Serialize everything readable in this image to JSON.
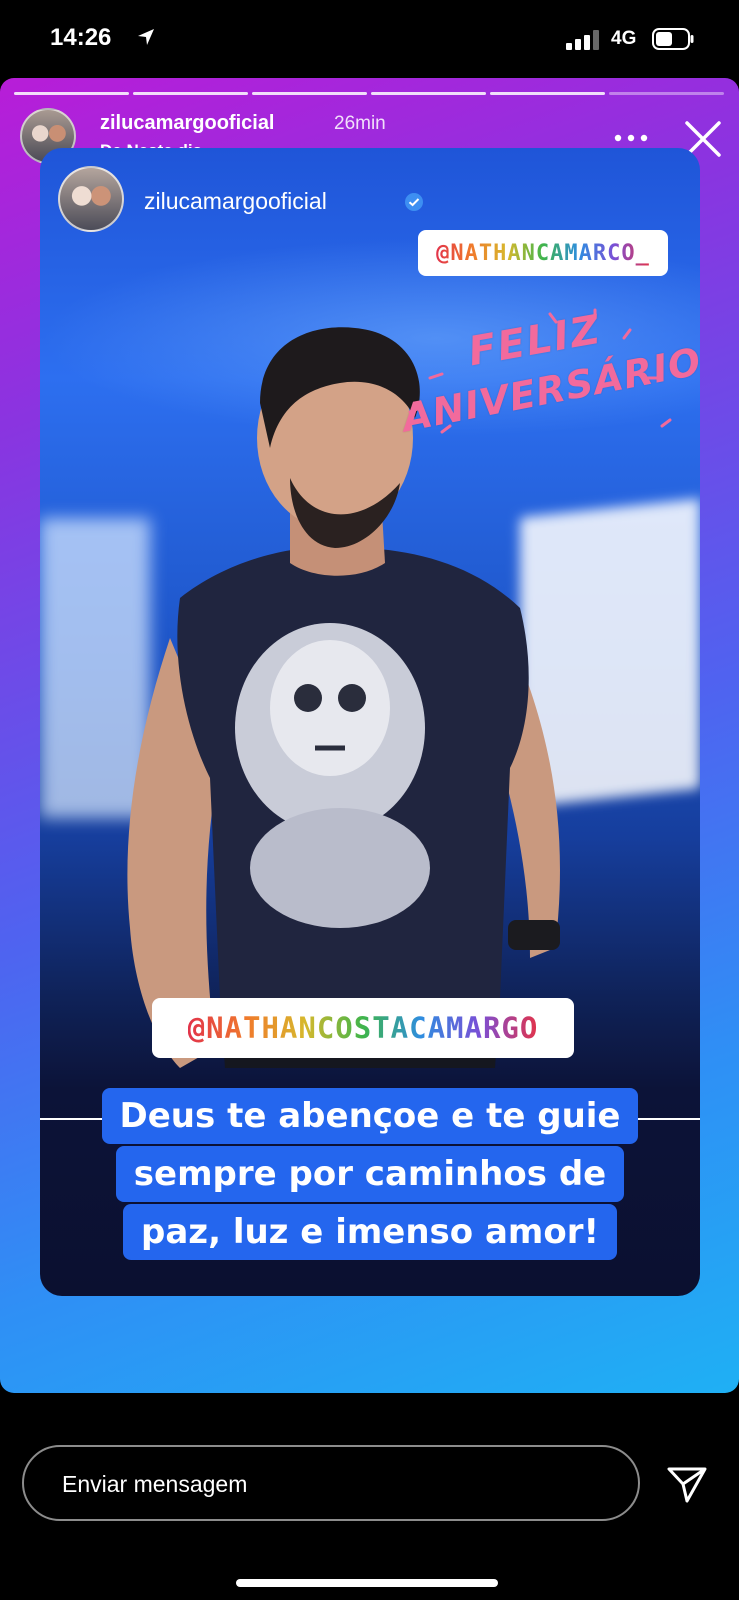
{
  "status_bar": {
    "time": "14:26",
    "network": "4G"
  },
  "story": {
    "progress": {
      "segments": 6,
      "current_index": 5
    },
    "username": "zilucamargooficial",
    "time_ago": "26min",
    "subtitle": "De Neste dia",
    "post": {
      "username": "zilucamargooficial",
      "mention_top": "@NATHANCAMARCO_",
      "birthday_line1": "FELIZ",
      "birthday_line2": "ANIVERSÁRIO!",
      "mention_middle": "@NATHANCOSTACAMARGO",
      "caption_lines": [
        "Deus te abençoe e te guie",
        "sempre por caminhos de",
        "paz, luz e imenso amor!"
      ]
    }
  },
  "footer": {
    "message_placeholder": "Enviar mensagem"
  },
  "colors": {
    "gradient_start": "#b81dd8",
    "gradient_end": "#1fb0f4",
    "caption_bg": "#2466ee",
    "birthday_text": "#f26a9c"
  },
  "icons": [
    "location-arrow-icon",
    "signal-icon",
    "battery-icon",
    "more-icon",
    "close-icon",
    "verified-icon",
    "send-icon"
  ]
}
